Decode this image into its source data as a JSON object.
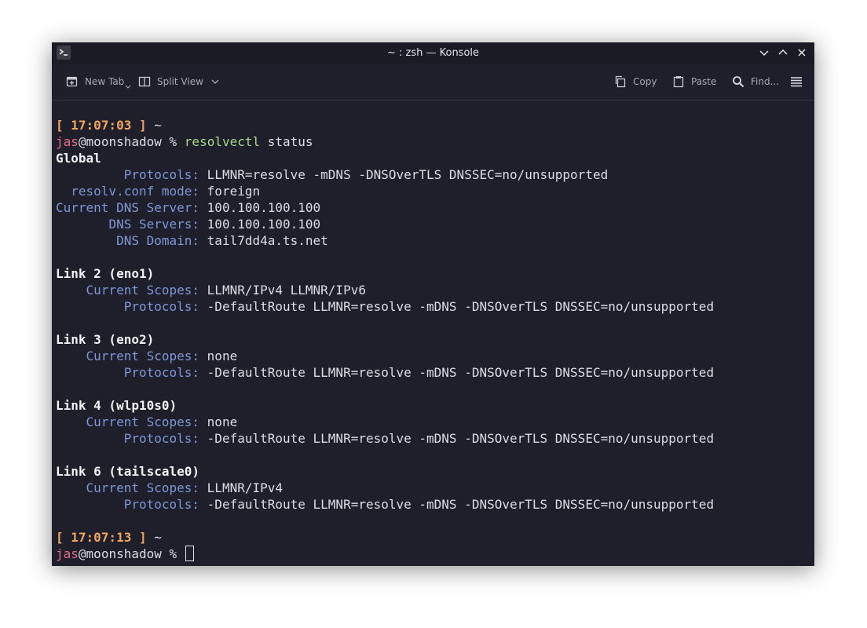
{
  "window": {
    "title": "~ : zsh — Konsole"
  },
  "toolbar": {
    "new_tab": "New Tab",
    "split_view": "Split View",
    "copy": "Copy",
    "paste": "Paste",
    "find": "Find..."
  },
  "terminal": {
    "prompt1": {
      "timestamp": "[ 17:07:03 ]",
      "dir": "~",
      "user": "jas",
      "at": "@",
      "host": "moonshadow",
      "symbol": "%",
      "command": "resolvectl",
      "args": "status"
    },
    "global": {
      "header": "Global",
      "protocols_key": "Protocols:",
      "protocols_val": "LLMNR=resolve -mDNS -DNSOverTLS DNSSEC=no/unsupported",
      "resolv_key": "resolv.conf mode:",
      "resolv_val": "foreign",
      "current_dns_key": "Current DNS Server:",
      "current_dns_val": "100.100.100.100",
      "dns_servers_key": "DNS Servers:",
      "dns_servers_val": "100.100.100.100",
      "dns_domain_key": "DNS Domain:",
      "dns_domain_val": "tail7dd4a.ts.net"
    },
    "links": [
      {
        "header": "Link 2 (eno1)",
        "scopes_key": "Current Scopes:",
        "scopes_val": "LLMNR/IPv4 LLMNR/IPv6",
        "protocols_key": "Protocols:",
        "protocols_val": "-DefaultRoute LLMNR=resolve -mDNS -DNSOverTLS DNSSEC=no/unsupported"
      },
      {
        "header": "Link 3 (eno2)",
        "scopes_key": "Current Scopes:",
        "scopes_val": "none",
        "protocols_key": "Protocols:",
        "protocols_val": "-DefaultRoute LLMNR=resolve -mDNS -DNSOverTLS DNSSEC=no/unsupported"
      },
      {
        "header": "Link 4 (wlp10s0)",
        "scopes_key": "Current Scopes:",
        "scopes_val": "none",
        "protocols_key": "Protocols:",
        "protocols_val": "-DefaultRoute LLMNR=resolve -mDNS -DNSOverTLS DNSSEC=no/unsupported"
      },
      {
        "header": "Link 6 (tailscale0)",
        "scopes_key": "Current Scopes:",
        "scopes_val": "LLMNR/IPv4",
        "protocols_key": "Protocols:",
        "protocols_val": "-DefaultRoute LLMNR=resolve -mDNS -DNSOverTLS DNSSEC=no/unsupported"
      }
    ],
    "prompt2": {
      "timestamp": "[ 17:07:13 ]",
      "dir": "~",
      "user": "jas",
      "at": "@",
      "host": "moonshadow",
      "symbol": "%"
    }
  },
  "colors": {
    "background": "#1e1f2b",
    "timestamp": "#f0a560",
    "user": "#ec6a86",
    "command": "#a6d98a",
    "key": "#7e97d6"
  }
}
